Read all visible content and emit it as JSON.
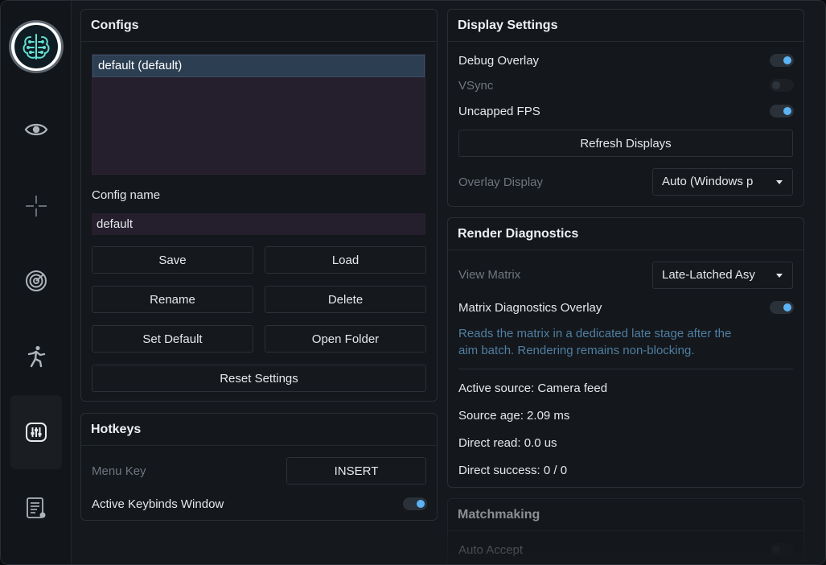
{
  "sidebar": {
    "items": [
      {
        "icon": "eye-icon"
      },
      {
        "icon": "crosshair-icon"
      },
      {
        "icon": "radar-icon"
      },
      {
        "icon": "running-figure-icon"
      },
      {
        "icon": "sliders-icon",
        "active": true
      },
      {
        "icon": "log-list-icon"
      }
    ]
  },
  "configs": {
    "title": "Configs",
    "list": [
      "default (default)"
    ],
    "config_name_label": "Config name",
    "config_name_value": "default",
    "buttons": {
      "save": "Save",
      "load": "Load",
      "rename": "Rename",
      "delete": "Delete",
      "set_default": "Set Default",
      "open_folder": "Open Folder",
      "reset": "Reset Settings"
    }
  },
  "hotkeys": {
    "title": "Hotkeys",
    "menu_key_label": "Menu Key",
    "menu_key_value": "INSERT",
    "keybinds_window_label": "Active Keybinds Window",
    "keybinds_window_on": true
  },
  "display": {
    "title": "Display Settings",
    "debug_overlay_label": "Debug Overlay",
    "debug_overlay_on": true,
    "vsync_label": "VSync",
    "vsync_on": false,
    "uncapped_fps_label": "Uncapped FPS",
    "uncapped_fps_on": true,
    "refresh_button": "Refresh Displays",
    "overlay_display_label": "Overlay Display",
    "overlay_display_value": "Auto (Windows p"
  },
  "render": {
    "title": "Render Diagnostics",
    "view_matrix_label": "View Matrix",
    "view_matrix_value": "Late-Latched Asy",
    "matrix_overlay_label": "Matrix Diagnostics Overlay",
    "matrix_overlay_on": true,
    "description_line1": "Reads the matrix in a dedicated late stage after the",
    "description_line2": "aim batch. Rendering remains non-blocking.",
    "active_source": "Active source: Camera feed",
    "source_age": "Source age: 2.09 ms",
    "direct_read": "Direct read: 0.0 us",
    "direct_success": "Direct success: 0 / 0"
  },
  "matchmaking": {
    "title": "Matchmaking",
    "auto_accept_label": "Auto Accept",
    "auto_accept_on": false
  },
  "colors": {
    "accent": "#5cb3f5",
    "list_selected": "#2c3e52",
    "list_bg": "#251f2d"
  }
}
